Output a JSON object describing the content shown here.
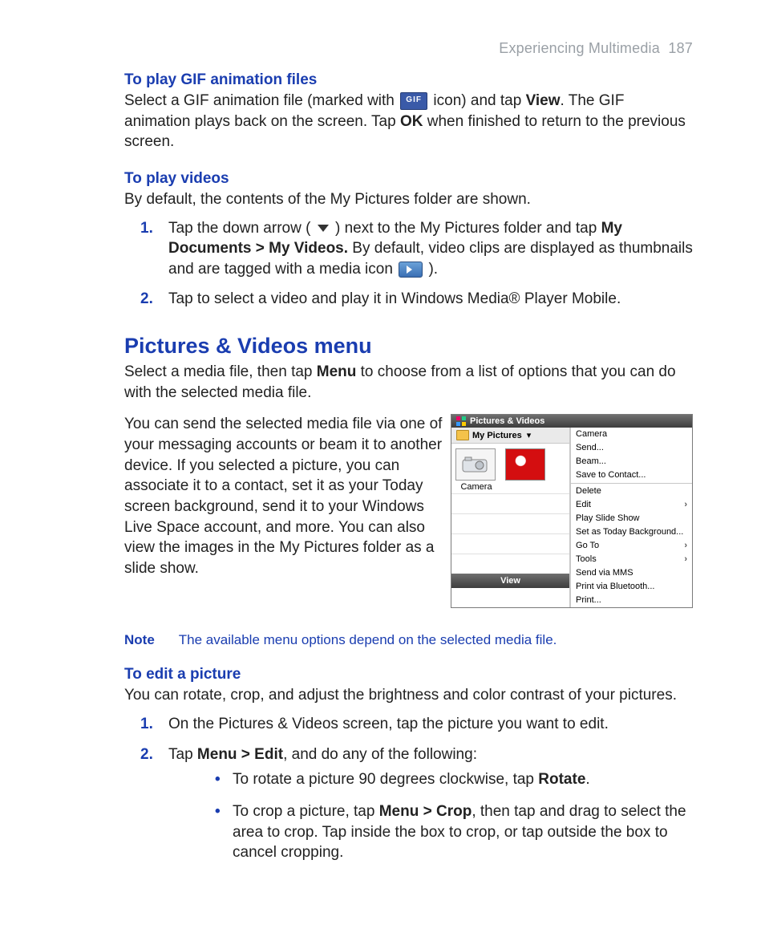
{
  "header": {
    "section": "Experiencing Multimedia",
    "page": "187"
  },
  "gif": {
    "heading": "To play GIF animation files",
    "p1a": "Select a GIF animation file (marked with ",
    "p1b": " icon) and tap ",
    "view": "View",
    "p1c": ". The GIF animation plays back on the screen. Tap ",
    "ok": "OK",
    "p1d": " when finished to return to the previous screen."
  },
  "videos": {
    "heading": "To play videos",
    "intro": "By default, the contents of the My Pictures folder are shown.",
    "li1a": "Tap the down arrow ( ",
    "li1b": " ) next to the My Pictures folder and tap ",
    "path_b": "My Documents > My Videos.",
    "li1c": " By default, video clips are displayed as thumbnails and are tagged with a media icon",
    "li1d": "  ).",
    "li2": "Tap to select a video and play it in Windows Media® Player Mobile."
  },
  "pvmenu": {
    "title": "Pictures & Videos menu",
    "p1a": "Select a media file, then tap ",
    "menu_b": "Menu",
    "p1b": " to choose from a list of options that you can do with the selected media file.",
    "p2": "You can send the selected media file via one of your messaging accounts or beam it to another device. If you selected a picture, you can associate it to a contact, set it as your Today screen background, send it to your Windows Live Space account, and more. You can also view the images in the My Pictures folder as a slide show."
  },
  "screenshot": {
    "title": "Pictures & Videos",
    "folder": "My Pictures",
    "thumb1": "Camera",
    "bottom": "View",
    "menu": {
      "camera": "Camera",
      "send": "Send...",
      "beam": "Beam...",
      "save_contact": "Save to Contact...",
      "delete": "Delete",
      "edit": "Edit",
      "slide": "Play Slide Show",
      "today": "Set as Today Background...",
      "goto": "Go To",
      "tools": "Tools",
      "mms": "Send via MMS",
      "bt": "Print via Bluetooth...",
      "print": "Print..."
    }
  },
  "note": {
    "label": "Note",
    "text": "The available menu options depend on the selected media file."
  },
  "edit": {
    "heading": "To edit a picture",
    "intro": "You can rotate, crop, and adjust the brightness and color contrast of your pictures.",
    "li1": "On the Pictures & Videos screen, tap the picture you want to edit.",
    "li2a": "Tap ",
    "li2b": "Menu > Edit",
    "li2c": ", and do any of the following:",
    "b1a": "To rotate a picture 90 degrees clockwise, tap ",
    "b1b": "Rotate",
    "b1c": ".",
    "b2a": "To crop a picture, tap ",
    "b2b": "Menu > Crop",
    "b2c": ", then tap and drag to select the area to crop. Tap inside the box to crop, or tap outside the box to cancel cropping."
  },
  "numbers": {
    "1": "1.",
    "2": "2."
  }
}
